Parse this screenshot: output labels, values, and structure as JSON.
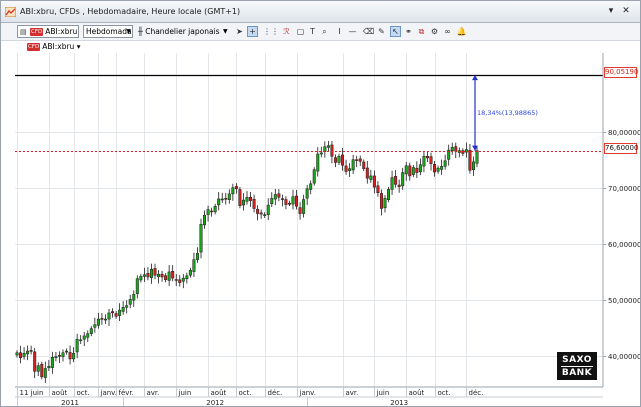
{
  "window": {
    "title": "ABI:xbru, CFDs , Hebdomadaire, Heure locale (GMT+1)",
    "controls": [
      "▾",
      "✕"
    ]
  },
  "toolbar": {
    "instrument": "ABI:xbru",
    "instrument_badge": "CFD",
    "timeframe": "Hebdomadaire",
    "chart_type": "Chandelier japonais",
    "icons": [
      "pointer-icon",
      "crosshair-icon",
      "grid-icon",
      "indicator-icon",
      "drawing-icon",
      "zoom-icon",
      "bar-icon",
      "line-tool-icon",
      "eraser-icon",
      "cursor-select-icon",
      "link-icon",
      "copy-icon",
      "settings-icon",
      "binoculars-icon",
      "alert-icon"
    ]
  },
  "subbar": {
    "instrument_label": "ABI:xbru",
    "badge": "CFD"
  },
  "price_markers": {
    "target": "90,05190",
    "current": "76,60000",
    "measure": "18,34%(13,98865)"
  },
  "logo": {
    "line1": "SAXO",
    "line2": "BANK"
  },
  "colors": {
    "up": "#19a619",
    "down": "#d62020",
    "wick": "#1a1a1a",
    "target_line": "#000000",
    "current_line": "#e02020",
    "measure": "#2233cc"
  },
  "chart_data": {
    "type": "candlestick",
    "title": "ABI:xbru, CFDs , Hebdomadaire, Heure locale (GMT+1)",
    "yticks": [
      "40,00000",
      "50,00000",
      "60,00000",
      "70,00000",
      "80,00000"
    ],
    "ytick_values": [
      40,
      50,
      60,
      70,
      80
    ],
    "ylim": [
      34.5,
      94.0
    ],
    "xticks": [
      "11 juin",
      "août",
      "oct.",
      "janv.",
      "févr.",
      "avr.",
      "juin",
      "août",
      "oct.",
      "déc.",
      "janv.",
      "avr.",
      "juin",
      "août",
      "oct.",
      "déc."
    ],
    "xtick_indices": [
      0,
      9,
      16,
      23,
      28,
      36,
      45,
      54,
      62,
      70,
      79,
      92,
      101,
      110,
      118,
      127
    ],
    "years": [
      "2011",
      "2012",
      "2013"
    ],
    "year_start_indices": [
      0,
      30,
      82,
      134
    ],
    "horizontal_lines": [
      {
        "value": 90.0519,
        "label": "90,05190"
      },
      {
        "value": 76.6,
        "label": "76,60000"
      }
    ],
    "measure": {
      "from_value": 76.6,
      "to_value": 90.0519,
      "at_index": 130,
      "label": "18,34%(13,98865)"
    },
    "closes": [
      40.6,
      39.7,
      40.5,
      40.9,
      41.0,
      37.3,
      38.3,
      36.3,
      37.8,
      38.2,
      39.8,
      39.9,
      40.0,
      40.6,
      40.9,
      39.5,
      40.5,
      43.0,
      42.9,
      43.6,
      44.0,
      44.9,
      45.6,
      46.6,
      46.7,
      46.6,
      47.7,
      47.7,
      47.1,
      48.2,
      48.7,
      49.0,
      50.1,
      51.0,
      53.8,
      54.2,
      54.5,
      54.1,
      55.5,
      54.4,
      54.6,
      54.1,
      53.6,
      55.0,
      53.9,
      53.6,
      53.1,
      53.9,
      54.3,
      55.3,
      57.2,
      58.3,
      63.5,
      65.1,
      66.1,
      65.7,
      66.7,
      68.0,
      68.0,
      68.1,
      68.9,
      70.0,
      69.8,
      66.8,
      67.8,
      68.3,
      67.7,
      66.3,
      65.4,
      65.3,
      65.2,
      66.9,
      68.1,
      68.8,
      68.3,
      67.9,
      67.0,
      67.2,
      68.4,
      66.7,
      65.4,
      67.9,
      69.8,
      70.7,
      73.2,
      76.0,
      76.2,
      77.3,
      77.5,
      75.6,
      74.5,
      75.6,
      74.0,
      72.9,
      73.4,
      75.0,
      74.9,
      74.7,
      73.4,
      71.7,
      72.1,
      70.1,
      69.1,
      66.3,
      68.1,
      69.7,
      71.8,
      70.6,
      70.2,
      72.7,
      73.9,
      72.1,
      73.6,
      72.7,
      74.1,
      75.6,
      75.3,
      74.3,
      72.8,
      73.5,
      73.8,
      74.8,
      76.7,
      77.2,
      76.5,
      76.6,
      76.1,
      76.8,
      73.1,
      74.6,
      76.6
    ],
    "series_name": "ABI:xbru"
  }
}
